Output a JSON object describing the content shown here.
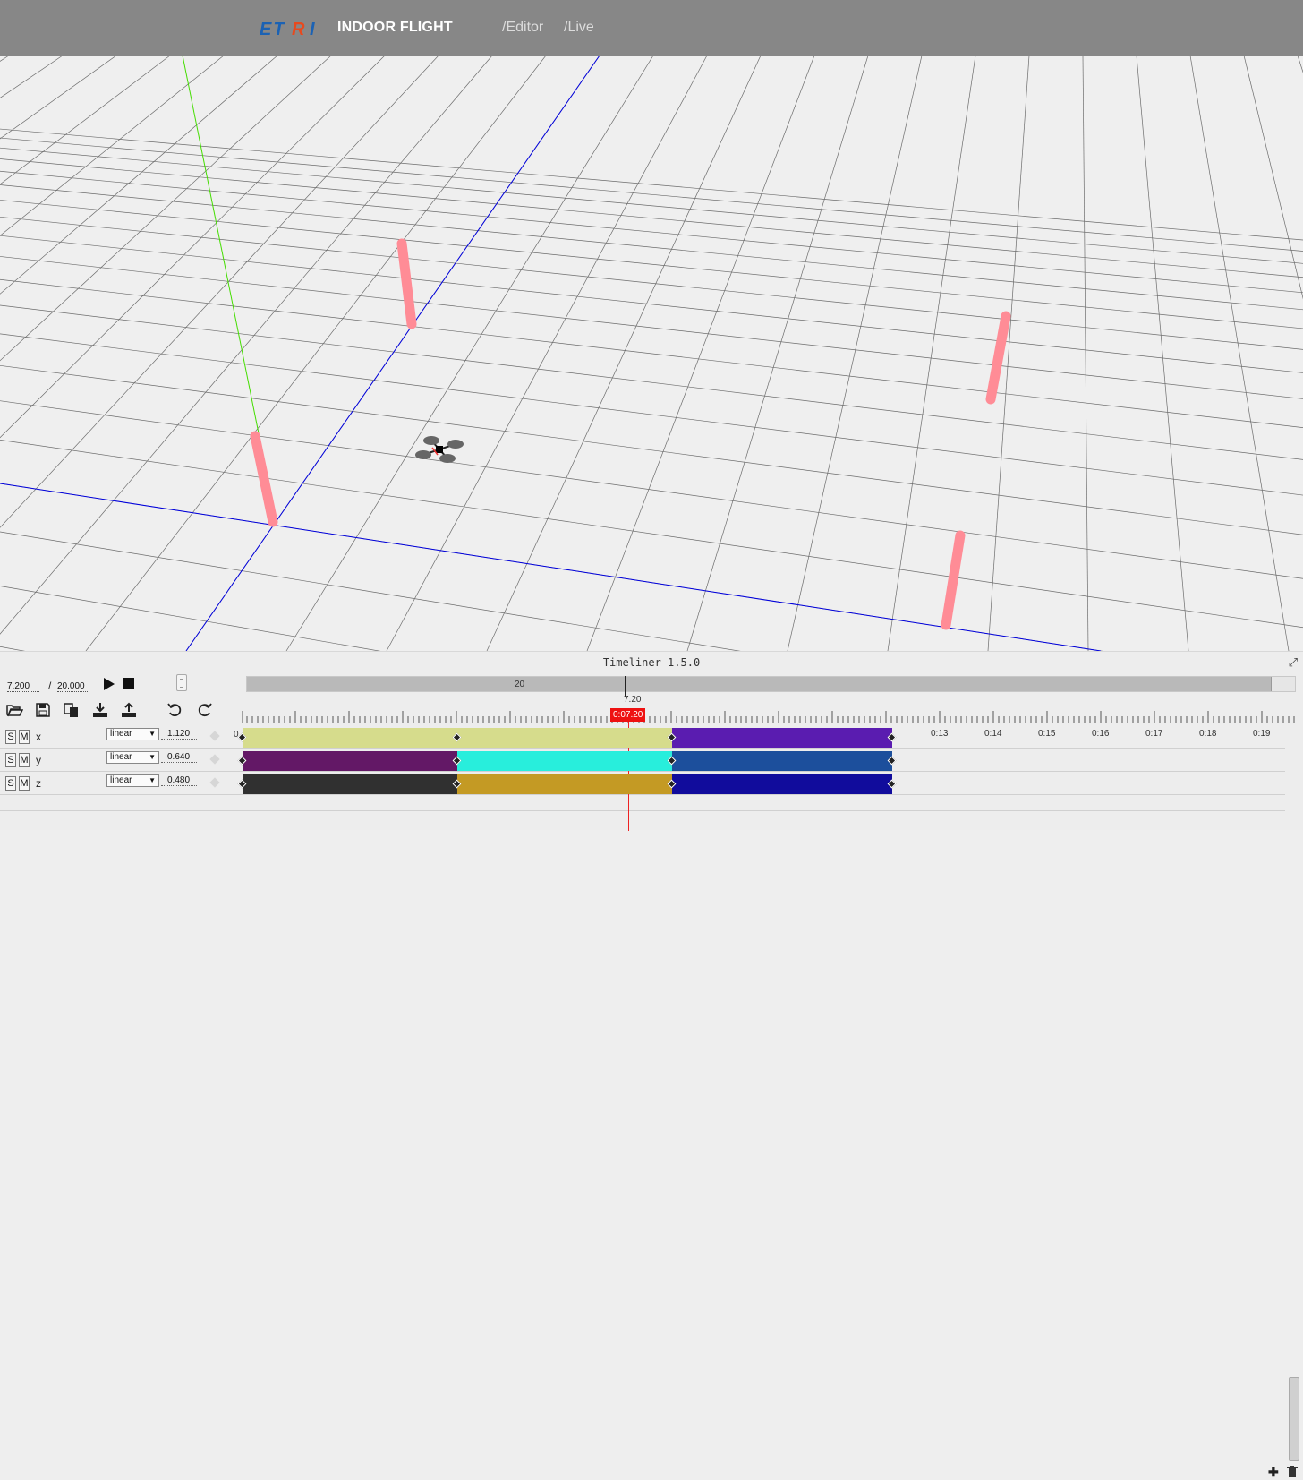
{
  "header": {
    "logo_text": "ETRI",
    "title": "INDOOR FLIGHT",
    "nav": [
      {
        "label": "/Editor"
      },
      {
        "label": "/Live"
      }
    ],
    "bg_color": "#878787"
  },
  "viewport": {
    "background": "#efefef",
    "grid_color": "#6c6c6c",
    "axis_x_color": "#0000dd",
    "axis_y_color": "#44dd00",
    "pole_color": "#ff8c96",
    "drone_icon": "quadcopter-icon"
  },
  "timeliner": {
    "title": "Timeliner 1.5.0",
    "current_time": "7.200",
    "separator": "/",
    "total_time": "20.000",
    "scroll_label": "20",
    "playhead_value": "7.20",
    "time_marker": "0:07.20",
    "tick_labels": [
      "0:13",
      "0:14",
      "0:15",
      "0:16",
      "0:17",
      "0:18",
      "0:19"
    ],
    "start_label": "0",
    "tools": [
      "open-folder-icon",
      "save-icon",
      "copy-icon",
      "download-icon",
      "upload-icon",
      "undo-icon",
      "redo-icon"
    ],
    "tracks": [
      {
        "name": "x",
        "solo": "S",
        "mute": "M",
        "interp": "linear",
        "value": "1.120",
        "segments": [
          {
            "from": 0,
            "to": 4,
            "color": "#d6dc8c"
          },
          {
            "from": 4,
            "to": 8,
            "color": "#d6dc8c"
          },
          {
            "from": 8,
            "to": 12.1,
            "color": "#5a1cb0"
          }
        ],
        "keys": [
          0,
          4,
          8,
          12.1
        ]
      },
      {
        "name": "y",
        "solo": "S",
        "mute": "M",
        "interp": "linear",
        "value": "0.640",
        "segments": [
          {
            "from": 0,
            "to": 4,
            "color": "#631866"
          },
          {
            "from": 4,
            "to": 8,
            "color": "#28eedc"
          },
          {
            "from": 8,
            "to": 12.1,
            "color": "#1c4f9c"
          }
        ],
        "keys": [
          0,
          4,
          8,
          12.1
        ]
      },
      {
        "name": "z",
        "solo": "S",
        "mute": "M",
        "interp": "linear",
        "value": "0.480",
        "segments": [
          {
            "from": 0,
            "to": 4,
            "color": "#303030"
          },
          {
            "from": 4,
            "to": 8,
            "color": "#c49a24"
          },
          {
            "from": 8,
            "to": 12.1,
            "color": "#110c9c"
          }
        ],
        "keys": [
          0,
          4,
          8,
          12.1
        ]
      }
    ]
  }
}
